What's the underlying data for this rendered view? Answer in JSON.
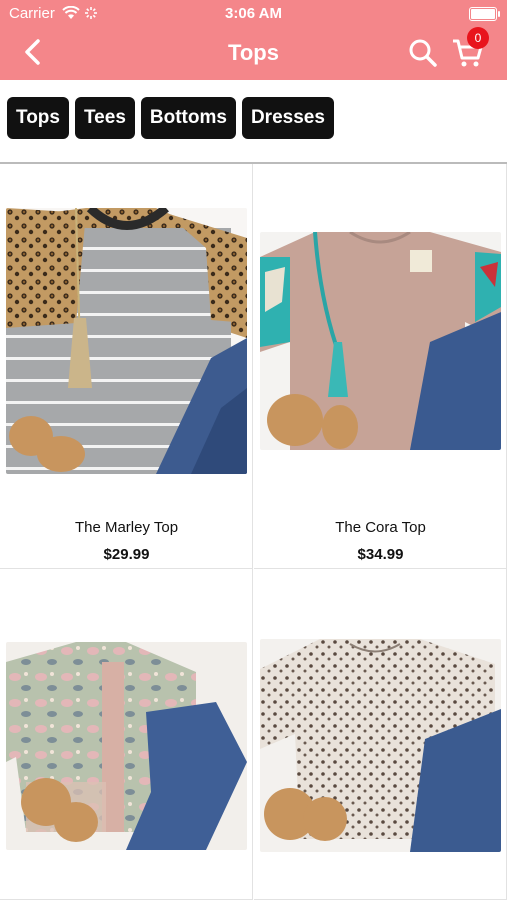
{
  "status_bar": {
    "carrier": "Carrier",
    "time": "3:06 AM"
  },
  "nav": {
    "title": "Tops",
    "back_icon": "chevron-left-icon",
    "search_icon": "search-icon",
    "cart_icon": "cart-icon",
    "cart_count": "0"
  },
  "filters": [
    "Tops",
    "Tees",
    "Bottoms",
    "Dresses"
  ],
  "products": [
    {
      "name": "The Marley Top",
      "price": "$29.99"
    },
    {
      "name": "The Cora Top",
      "price": "$34.99"
    },
    {
      "name": "",
      "price": ""
    },
    {
      "name": "",
      "price": ""
    }
  ],
  "colors": {
    "header": "#f4868a",
    "badge": "#e8141c",
    "chip": "#111111"
  }
}
